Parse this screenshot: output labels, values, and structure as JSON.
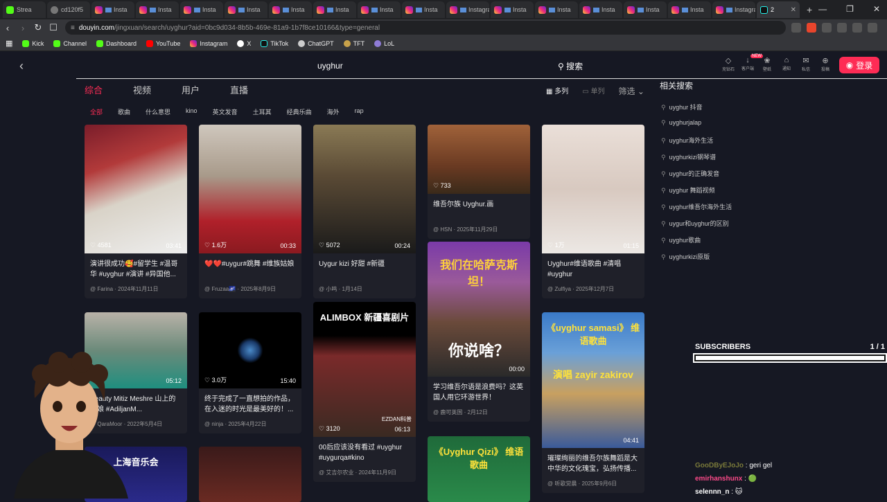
{
  "browser": {
    "tabs": [
      {
        "label": "Strea",
        "icon": "kick"
      },
      {
        "label": "cd120f5",
        "icon": "globe"
      },
      {
        "label": "Insta",
        "icon": "instagram"
      },
      {
        "label": "Insta",
        "icon": "instagram"
      },
      {
        "label": "Insta",
        "icon": "instagram"
      },
      {
        "label": "Insta",
        "icon": "instagram"
      },
      {
        "label": "Insta",
        "icon": "instagram"
      },
      {
        "label": "Insta",
        "icon": "instagram"
      },
      {
        "label": "Insta",
        "icon": "instagram"
      },
      {
        "label": "Insta",
        "icon": "instagram"
      },
      {
        "label": "Instagra",
        "icon": "instagram"
      },
      {
        "label": "Insta",
        "icon": "instagram"
      },
      {
        "label": "Insta",
        "icon": "instagram"
      },
      {
        "label": "Insta",
        "icon": "instagram"
      },
      {
        "label": "Insta",
        "icon": "instagram"
      },
      {
        "label": "Insta",
        "icon": "instagram"
      },
      {
        "label": "Instagra",
        "icon": "instagram"
      },
      {
        "label": "2",
        "icon": "tiktok",
        "active": true
      }
    ],
    "new_tab_label": "+",
    "url_host": "douyin.com",
    "url_path": "/jingxuan/search/uyghur?aid=0bc9d034-8b5b-469e-81a9-1b7f8ce10166&type=general",
    "bookmarks": [
      {
        "label": "Kick",
        "icon": "kick"
      },
      {
        "label": "Channel",
        "icon": "kick"
      },
      {
        "label": "Dashboard",
        "icon": "kick"
      },
      {
        "label": "YouTube",
        "icon": "youtube"
      },
      {
        "label": "Instagram",
        "icon": "instagram"
      },
      {
        "label": "X",
        "icon": "x"
      },
      {
        "label": "TikTok",
        "icon": "tiktok"
      },
      {
        "label": "ChatGPT",
        "icon": "chatgpt"
      },
      {
        "label": "TFT",
        "icon": "tft"
      },
      {
        "label": "LoL",
        "icon": "lol"
      }
    ]
  },
  "douyin": {
    "search_query": "uyghur",
    "search_button": "搜索",
    "login_button": "登录",
    "top_icons": [
      {
        "label": "充钻石"
      },
      {
        "label": "客户端",
        "badge": "NEW"
      },
      {
        "label": "壁纸"
      },
      {
        "label": "通知"
      },
      {
        "label": "私信"
      },
      {
        "label": "投稿"
      }
    ],
    "main_tabs": [
      {
        "label": "综合",
        "active": true
      },
      {
        "label": "视频"
      },
      {
        "label": "用户"
      },
      {
        "label": "直播"
      }
    ],
    "view_modes": [
      {
        "label": "多列",
        "active": true
      },
      {
        "label": "单列"
      }
    ],
    "filter_label": "筛选",
    "sub_tabs": [
      {
        "label": "全部",
        "active": true
      },
      {
        "label": "歌曲"
      },
      {
        "label": "什么意思"
      },
      {
        "label": "kino"
      },
      {
        "label": "英文发音"
      },
      {
        "label": "土耳其"
      },
      {
        "label": "经典乐曲"
      },
      {
        "label": "海外"
      },
      {
        "label": "rap"
      }
    ],
    "related_title": "相关搜索",
    "related": [
      "uyghur 抖音",
      "uyghurjalap",
      "uyghur海外生活",
      "uyghurkizi钢琴谱",
      "uyghur的正确发音",
      "uyghur 舞蹈视频",
      "uyghur维吾尔海外生活",
      "uygur和uyghur的区别",
      "uyghur歌曲",
      "uyghurkizi原版"
    ],
    "cards": [
      {
        "title": "演讲很成功🥰#留学生 #温哥华 #uyghur #演讲 #异国他...",
        "author": "Farina",
        "date": "2024年11月11日",
        "likes": "4581",
        "duration": "03:41",
        "overlay": ""
      },
      {
        "title": "❤️❤️#uygur#跳舞 #维族姑娘",
        "author": "Fruzaa🌌",
        "date": "2025年8月9日",
        "likes": "1.6万",
        "duration": "00:33",
        "overlay": ""
      },
      {
        "title": "Uygur kizi 好甜 #新疆",
        "author": "小鸣",
        "date": "1月14日",
        "likes": "5072",
        "duration": "00:24",
        "overlay": ""
      },
      {
        "title": "维吾尔族 Uyghur.画",
        "author": "HSN",
        "date": "2025年11月29日",
        "likes": "733",
        "duration": "",
        "overlay": ""
      },
      {
        "title": "Uyghur#维语歌曲 #清唱#uyghur",
        "author": "Zulfiya",
        "date": "2025年12月7日",
        "likes": "1万",
        "duration": "01:15",
        "overlay": ""
      },
      {
        "title": "Beauty Mitiz Meshre 山上的姑娘 #AdiljanM...",
        "author": "QaraMoor",
        "date": "2022年5月4日",
        "likes": "",
        "duration": "05:12",
        "overlay": ""
      },
      {
        "title": "终于完成了一直想拍的作品，在入迷的时光是最美好的！...",
        "author": "ninja",
        "date": "2025年4月22日",
        "likes": "3.0万",
        "duration": "15:40",
        "overlay": ""
      },
      {
        "title": "00后应该没有看过 #uyghur #uygurqa#kino",
        "author": "艾吉尔农业",
        "date": "2024年11月9日",
        "likes": "3120",
        "duration": "06:13",
        "overlay": "ALIMBOX 新疆喜剧片",
        "corner": "EZDAN科普"
      },
      {
        "title": "学习维吾尔语是浪费吗？这英国人用它环游世界！",
        "author": "鹿可英国",
        "date": "2月12日",
        "likes": "",
        "duration": "00:00",
        "overlay": "我们在哈萨克斯坦！",
        "overlay2": "你说啥？"
      },
      {
        "title": "璀璨绚丽的维吾尔族舞蹈是大中华的文化瑰宝，弘扬传播...",
        "author": "听歌觉晨",
        "date": "2025年9月6日",
        "likes": "",
        "duration": "04:41",
        "overlay": "《uyghur samasi》 维语歌曲",
        "overlay2": "演唱 zayir zakirov"
      },
      {
        "title": "",
        "author": "",
        "date": "",
        "likes": "",
        "duration": "",
        "overlay": "上海音乐会"
      },
      {
        "title": "",
        "author": "",
        "date": "",
        "likes": "",
        "duration": "",
        "overlay": ""
      },
      {
        "title": "",
        "author": "",
        "date": "",
        "likes": "",
        "duration": "",
        "overlay": "《Uyghur Qizi》 维语歌曲"
      }
    ]
  },
  "overlay": {
    "subscribers_label": "SUBSCRIBERS",
    "subscribers_count": "1 / 1",
    "subscribers_progress": 1.0,
    "chat": [
      {
        "user": "GooDByEJoJo",
        "message": "geri gel",
        "color": "#7a7a3a"
      },
      {
        "user": "emirhanshunx",
        "message": "🟢",
        "color": "#ff4a8a"
      },
      {
        "user": "selennn_n",
        "message": "🐱",
        "color": "#ffffff"
      }
    ]
  },
  "colors": {
    "accent": "#fe2c55",
    "page_bg": "#161823",
    "card_bg": "#1f2029"
  }
}
